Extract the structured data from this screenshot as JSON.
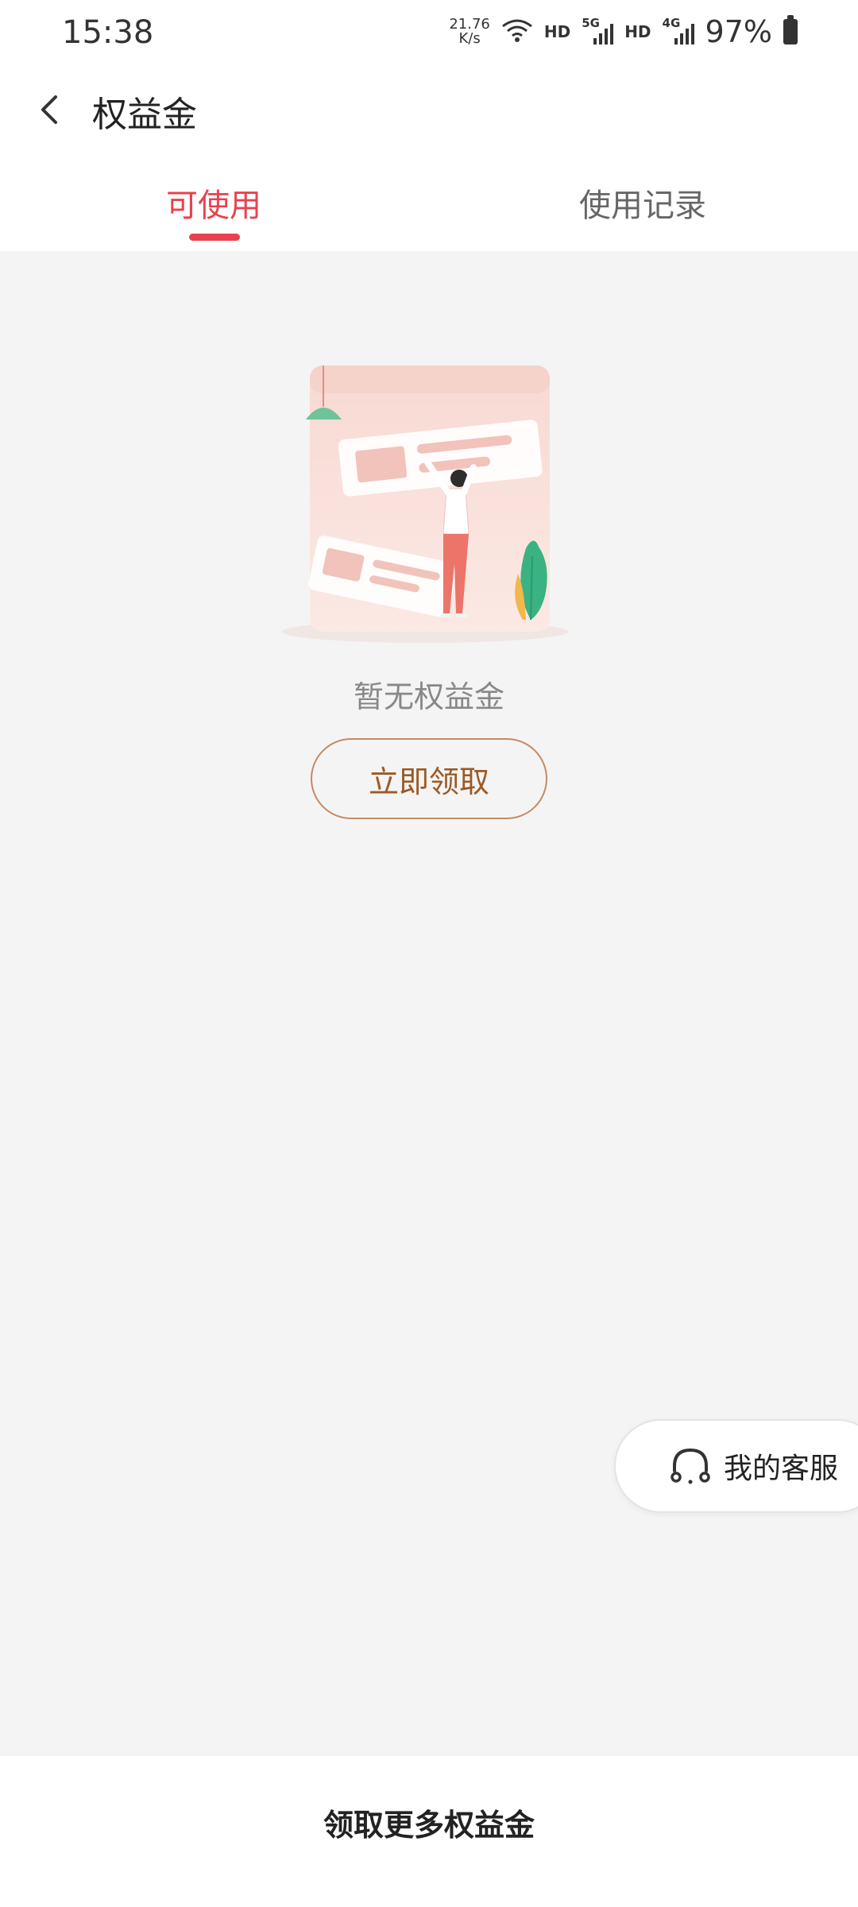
{
  "status_bar": {
    "time": "15:38",
    "net_speed_value": "21.76",
    "net_speed_unit": "K/s",
    "hd1": "HD",
    "sig1_gen": "5G",
    "hd2": "HD",
    "sig2_gen": "4G",
    "battery": "97%"
  },
  "header": {
    "title": "权益金"
  },
  "tabs": [
    {
      "label": "可使用",
      "active": true
    },
    {
      "label": "使用记录",
      "active": false
    }
  ],
  "empty_state": {
    "message": "暂无权益金",
    "action_label": "立即领取"
  },
  "floating": {
    "service_label": "我的客服"
  },
  "bottom": {
    "link_label": "领取更多权益金"
  },
  "colors": {
    "accent": "#e8424f",
    "button_border": "#c58b62",
    "button_text": "#9b5a25",
    "background": "#f4f4f4"
  }
}
